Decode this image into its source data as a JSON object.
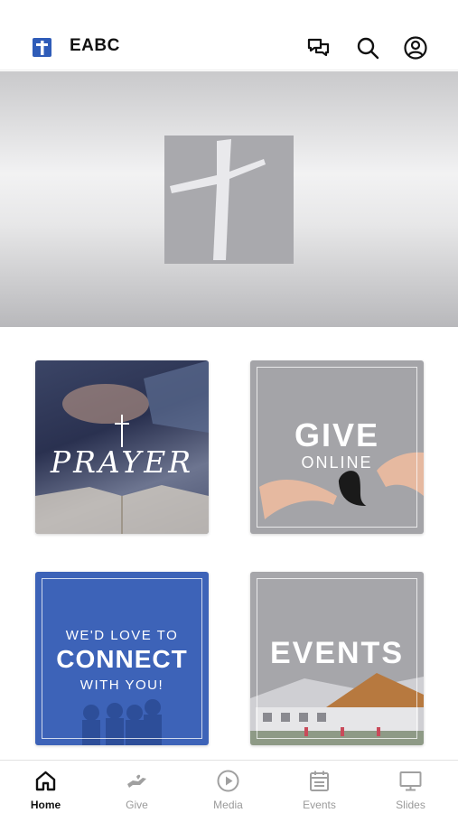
{
  "header": {
    "title": "EABC",
    "icons": [
      "chat-icon",
      "search-icon",
      "profile-icon"
    ]
  },
  "tiles": {
    "prayer": {
      "text": "PRAYER"
    },
    "give": {
      "line1": "GIVE",
      "line2": "ONLINE"
    },
    "connect": {
      "line1": "WE'D LOVE TO",
      "line2": "CONNECT",
      "line3": "WITH YOU!"
    },
    "events": {
      "text": "EVENTS"
    }
  },
  "tabs": [
    {
      "label": "Home",
      "icon": "home-icon",
      "active": true
    },
    {
      "label": "Give",
      "icon": "give-icon",
      "active": false
    },
    {
      "label": "Media",
      "icon": "play-icon",
      "active": false
    },
    {
      "label": "Events",
      "icon": "calendar-icon",
      "active": false
    },
    {
      "label": "Slides",
      "icon": "monitor-icon",
      "active": false
    }
  ],
  "colors": {
    "brand": "#2f5cb8",
    "active_tab": "#111111",
    "inactive_tab": "#9a9a9a"
  }
}
